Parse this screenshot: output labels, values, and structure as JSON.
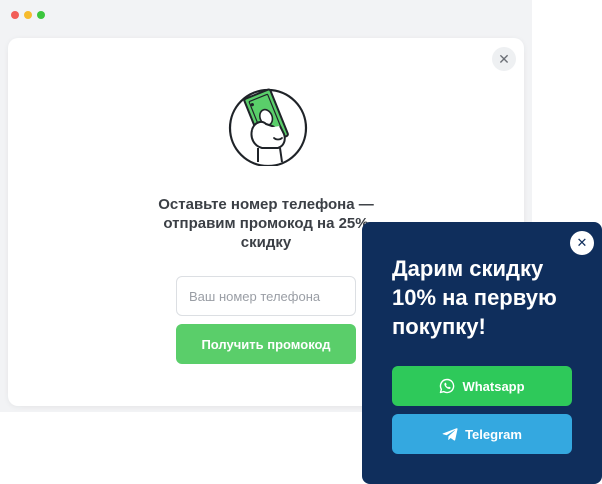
{
  "colors": {
    "window_dot_close": "#f25d57",
    "window_dot_minimize": "#f6bb2d",
    "window_dot_maximize": "#3cc63e",
    "primary_green": "#5ace6a",
    "widget_background": "#0f2e5c",
    "whatsapp_green": "#2ec95a",
    "telegram_blue": "#34a8e0"
  },
  "popup": {
    "close_icon": "close-icon",
    "illustration": "hand-holding-money-icon",
    "title": "Оставьте номер телефона — отправим промокод на 25% скидку",
    "phone_input": {
      "value": "",
      "placeholder": "Ваш номер телефона"
    },
    "submit_label": "Получить промокод"
  },
  "widget": {
    "close_icon": "close-icon",
    "title": "Дарим скидку 10% на первую покупку!",
    "buttons": [
      {
        "label": "Whatsapp",
        "icon": "whatsapp-icon"
      },
      {
        "label": "Telegram",
        "icon": "telegram-icon"
      }
    ]
  }
}
